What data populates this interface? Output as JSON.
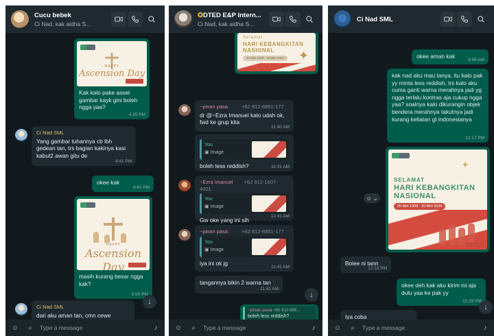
{
  "panel1": {
    "title": "Cucu bebek",
    "subtitle": "Ci Nad, kak aidha S...",
    "messages": [
      {
        "text": "Kak kalo pake asset gambar kayk gini boleh ngga yaa?",
        "time": "4:25 PM"
      },
      {
        "sender": "Ci Nad SML",
        "text": "Yang gambar tuhannya cb lbh gedean tan, trs bagian kakinya kasi kabut2 awan gitu de",
        "time": "4:41 PM"
      },
      {
        "text": "okee kak",
        "time": "4:42 PM"
      },
      {
        "text": "masih kurang besar ngga kak?",
        "time": "5:00 PM"
      },
      {
        "sender": "Ci Nad SML",
        "text": "dari aku aman tan, cmn cewe"
      }
    ],
    "poster_a": {
      "happy": "HAPPY",
      "title": "Ascension Day"
    },
    "poster_b": {
      "happy": "HAPPY",
      "title": "Ascension Day"
    },
    "composer_placeholder": "Type a message"
  },
  "panel2": {
    "title": "DTED E&P Intern...",
    "subtitle": "Ci Nad, kak aidha S...",
    "poster": {
      "selamat": "Selamat",
      "title_1": "HARI KEBANGKITAN",
      "title_2": "NASIONAL",
      "date": "20 MEI 1908 - 20 MEI 2024"
    },
    "messages": [
      {
        "sender": "~pinan pasa",
        "phone": "+62 812-8851-177",
        "text": "dr @~Ezra Imanuel kalo udah ok, fwd ke grup kita",
        "time": "11:40 AM"
      },
      {
        "quote_you": "You",
        "quote_label": "Image",
        "text": "boleh less reddish?",
        "time": "11:41 AM"
      },
      {
        "sender": "~Ezra Imanuel",
        "phone": "+62 812-1607-4001",
        "quote_you": "You",
        "quote_label": "Image",
        "text": "Gw oke yang ini sih",
        "time": "11:41 AM"
      },
      {
        "sender": "~pinan pasa",
        "phone": "+62 812-8851-177",
        "quote_you": "You",
        "quote_label": "Image",
        "text": "iya ini ok jg",
        "time": "11:41 AM"
      },
      {
        "text": "tangannya bikin 2 warna tan",
        "time": "11:41 AM"
      },
      {
        "sender": "~pinan pasa",
        "phone": "+62 812-885...",
        "text": "boleh less reddish?"
      }
    ],
    "composer_placeholder": "Type a message"
  },
  "panel3": {
    "title": "Ci Nad SML",
    "messages": [
      {
        "text": "okee aman kak",
        "time": "9:56 AM"
      },
      {
        "text": "kak nad aku mau tanya, itu kalo pak yy minta less reddish, trs kalo aku cuma ganti warna merahnya jadi yg ngga terlalu kontras aja cukup ngga yaa? soalnya kalo dikurangin objek bendera merahnya takutnya jadi kurang keliatan gt indonesianya",
        "time": "12:17 PM"
      },
      {
        "text": "Bolee ni tann",
        "time": "12:18 PM"
      },
      {
        "text": "okee deh kak aku kirim ini aja dulu yaa ke pak yy",
        "time": "12:19 PM"
      },
      {
        "text": "Iya coba"
      }
    ],
    "poster": {
      "selamat": "SELAMAT",
      "title_1": "HARI KEBANGKITAN",
      "title_2": "NASIONAL",
      "date": "20 Mei 1908 - 20 Mei 2024"
    },
    "composer_placeholder": "Type a message"
  },
  "colors": {
    "outgoing": "#005c4b",
    "incoming": "#1e2a30",
    "background": "#11191d",
    "header": "#1f2a30"
  }
}
